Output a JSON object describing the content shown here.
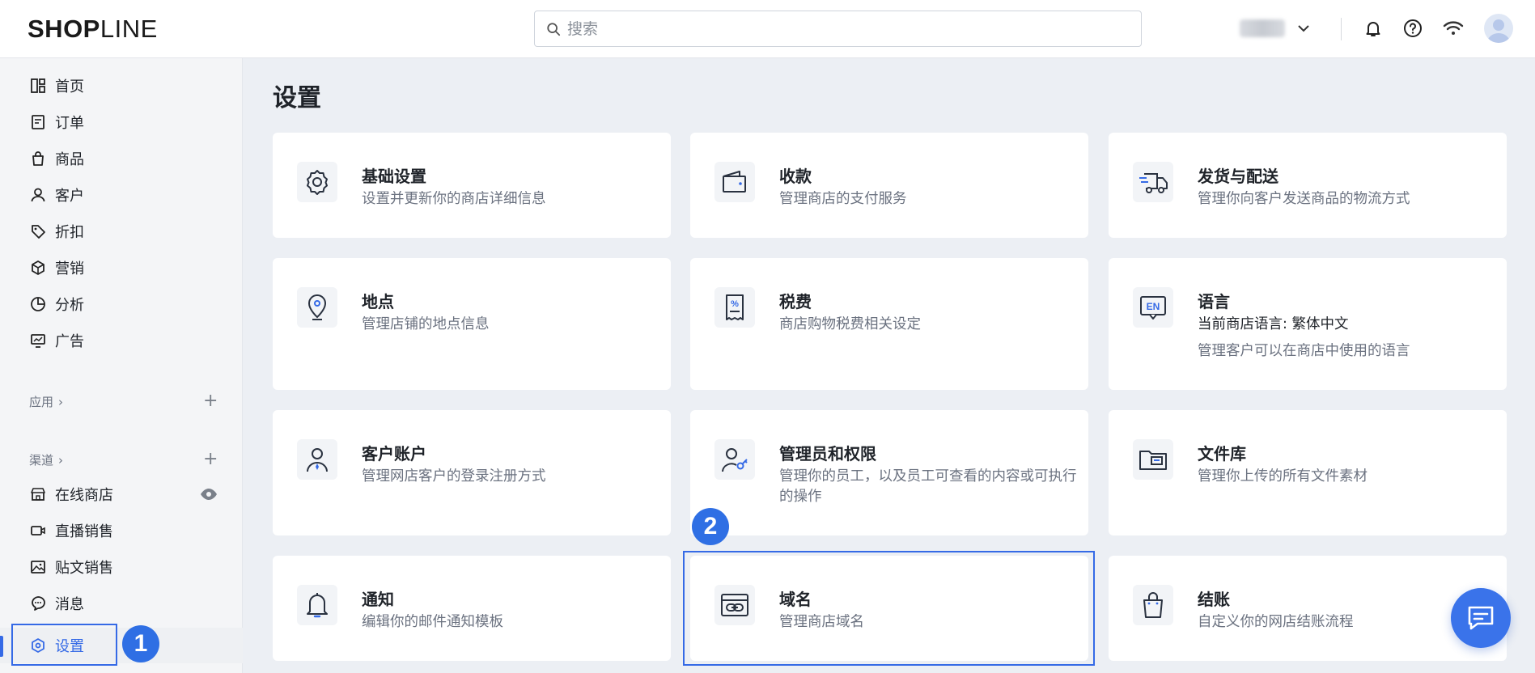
{
  "header": {
    "logo_bold": "SHOP",
    "logo_light": "LINE",
    "search_placeholder": "搜索"
  },
  "sidebar": {
    "items": [
      {
        "label": "首页",
        "icon": "home-icon"
      },
      {
        "label": "订单",
        "icon": "order-icon"
      },
      {
        "label": "商品",
        "icon": "bag-icon"
      },
      {
        "label": "客户",
        "icon": "user-icon"
      },
      {
        "label": "折扣",
        "icon": "tag-icon"
      },
      {
        "label": "营销",
        "icon": "cube-icon"
      },
      {
        "label": "分析",
        "icon": "pie-chart-icon"
      },
      {
        "label": "广告",
        "icon": "ad-monitor-icon"
      }
    ],
    "apps_label": "应用",
    "channels_label": "渠道",
    "channels": [
      {
        "label": "在线商店",
        "icon": "storefront-icon"
      },
      {
        "label": "直播销售",
        "icon": "video-icon"
      },
      {
        "label": "贴文销售",
        "icon": "image-post-icon"
      },
      {
        "label": "消息",
        "icon": "chat-bubble-icon"
      }
    ],
    "settings_label": "设置"
  },
  "badges": {
    "one": "1",
    "two": "2"
  },
  "main": {
    "title": "设置",
    "cards": [
      {
        "title": "基础设置",
        "desc": "设置并更新你的商店详细信息",
        "icon": "gear-icon"
      },
      {
        "title": "收款",
        "desc": "管理商店的支付服务",
        "icon": "wallet-icon"
      },
      {
        "title": "发货与配送",
        "desc": "管理你向客户发送商品的物流方式",
        "icon": "truck-icon"
      },
      {
        "title": "地点",
        "desc": "管理店铺的地点信息",
        "icon": "location-pin-icon"
      },
      {
        "title": "税费",
        "desc": "商店购物税费相关设定",
        "icon": "tax-receipt-icon"
      },
      {
        "title": "语言",
        "desc": "当前商店语言: 繁体中文",
        "desc2": "管理客户可以在商店中使用的语言",
        "icon": "language-en-icon"
      },
      {
        "title": "客户账户",
        "desc": "管理网店客户的登录注册方式",
        "icon": "customer-account-icon"
      },
      {
        "title": "管理员和权限",
        "desc": "管理你的员工，以及员工可查看的内容或可执行的操作",
        "icon": "admin-key-icon"
      },
      {
        "title": "文件库",
        "desc": "管理你上传的所有文件素材",
        "icon": "folder-icon"
      },
      {
        "title": "通知",
        "desc": "编辑你的邮件通知模板",
        "icon": "bell-icon"
      },
      {
        "title": "域名",
        "desc": "管理商店域名",
        "icon": "domain-link-icon"
      },
      {
        "title": "结账",
        "desc": "自定义你的网店结账流程",
        "icon": "checkout-bag-icon"
      }
    ]
  }
}
